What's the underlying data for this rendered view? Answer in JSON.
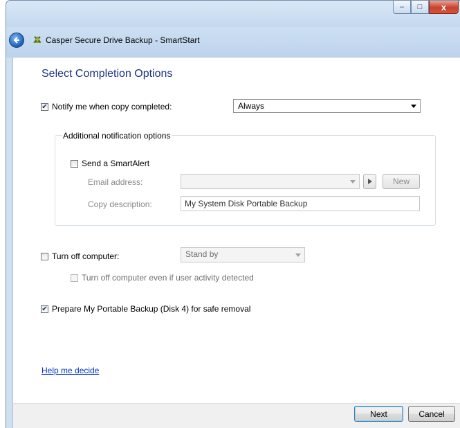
{
  "window": {
    "app_title": "Casper Secure Drive Backup - SmartStart",
    "minimize_glyph": "‒",
    "maximize_glyph": "□",
    "close_glyph": "x"
  },
  "page": {
    "heading": "Select Completion Options",
    "notify": {
      "label": "Notify me when copy completed:",
      "checked": true,
      "selected": "Always"
    },
    "additional": {
      "legend": "Additional notification options",
      "smartalert": {
        "label": "Send a SmartAlert",
        "checked": false
      },
      "email_label": "Email address:",
      "email_value": "",
      "new_button": "New",
      "copy_desc_label": "Copy description:",
      "copy_desc_value": "My System Disk Portable Backup"
    },
    "turnoff": {
      "label": "Turn off computer:",
      "checked": false,
      "selected": "Stand by",
      "even_if_active_label": "Turn off computer even if user activity detected",
      "even_if_active_checked": false
    },
    "prepare": {
      "label": "Prepare My Portable Backup (Disk 4) for safe removal",
      "checked": true
    },
    "help_link": "Help me decide"
  },
  "footer": {
    "next": "Next",
    "cancel": "Cancel"
  },
  "icons": {
    "back": "back-arrow-icon",
    "app": "casper-app-icon",
    "check": "✔"
  }
}
